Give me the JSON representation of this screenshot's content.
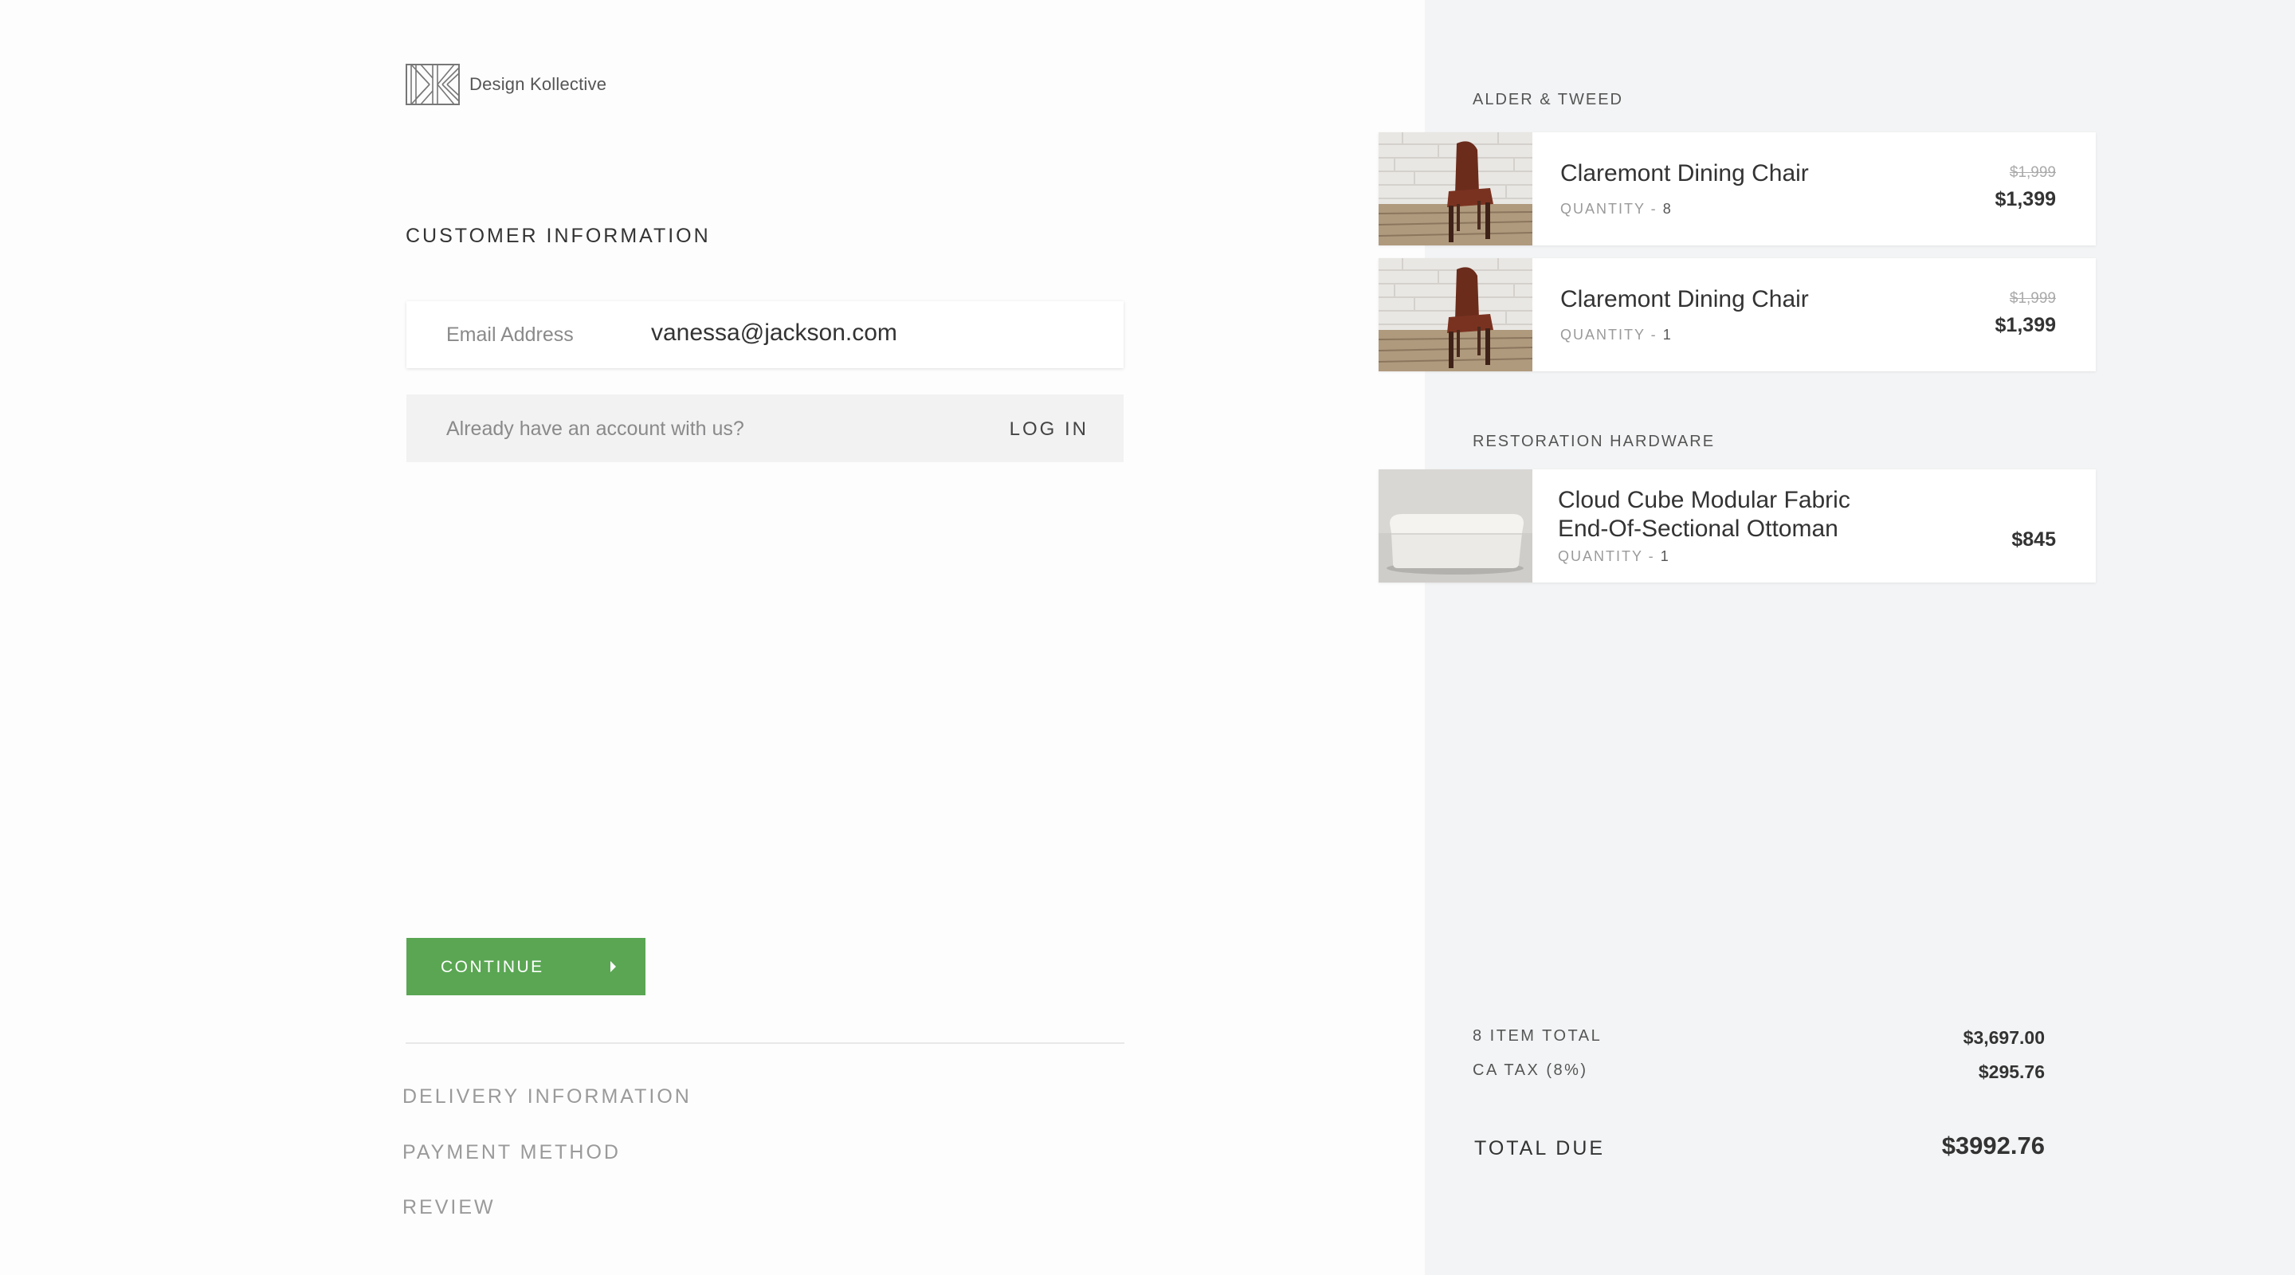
{
  "brand": {
    "name": "Design Kollective"
  },
  "customer": {
    "title": "CUSTOMER INFORMATION",
    "email_label": "Email Address",
    "email_value": "vanessa@jackson.com",
    "account_prompt": "Already have an account with us?",
    "login_label": "LOG IN"
  },
  "actions": {
    "continue_label": "CONTINUE"
  },
  "steps": [
    {
      "label": "DELIVERY INFORMATION"
    },
    {
      "label": "PAYMENT METHOD"
    },
    {
      "label": "REVIEW"
    }
  ],
  "cart": {
    "groups": [
      {
        "vendor": "ALDER & TWEED",
        "items": [
          {
            "name": "Claremont Dining Chair",
            "qty_label": "QUANTITY - ",
            "qty": "8",
            "old_price": "$1,999",
            "price": "$1,399",
            "thumbnail": "leather-chair"
          },
          {
            "name": "Claremont Dining Chair",
            "qty_label": "QUANTITY - ",
            "qty": "1",
            "old_price": "$1,999",
            "price": "$1,399",
            "thumbnail": "leather-chair"
          }
        ]
      },
      {
        "vendor": "RESTORATION HARDWARE",
        "items": [
          {
            "name_line1": "Cloud Cube Modular Fabric",
            "name_line2": "End-Of-Sectional Ottoman",
            "qty_label": "QUANTITY - ",
            "qty": "1",
            "price": "$845",
            "thumbnail": "white-ottoman"
          }
        ]
      }
    ]
  },
  "summary": {
    "items_label": "8 ITEM TOTAL",
    "items_value": "$3,697.00",
    "tax_label": "CA TAX (8%)",
    "tax_value": "$295.76",
    "total_label": "TOTAL DUE",
    "total_value": "$3992.76"
  },
  "colors": {
    "accent": "#5aa653",
    "sidebar_bg": "#f3f4f5",
    "text": "#333333",
    "muted": "#9a9a9a"
  },
  "icons": {
    "logo": "dk-logo-icon",
    "continue_arrow": "caret-right-icon"
  }
}
